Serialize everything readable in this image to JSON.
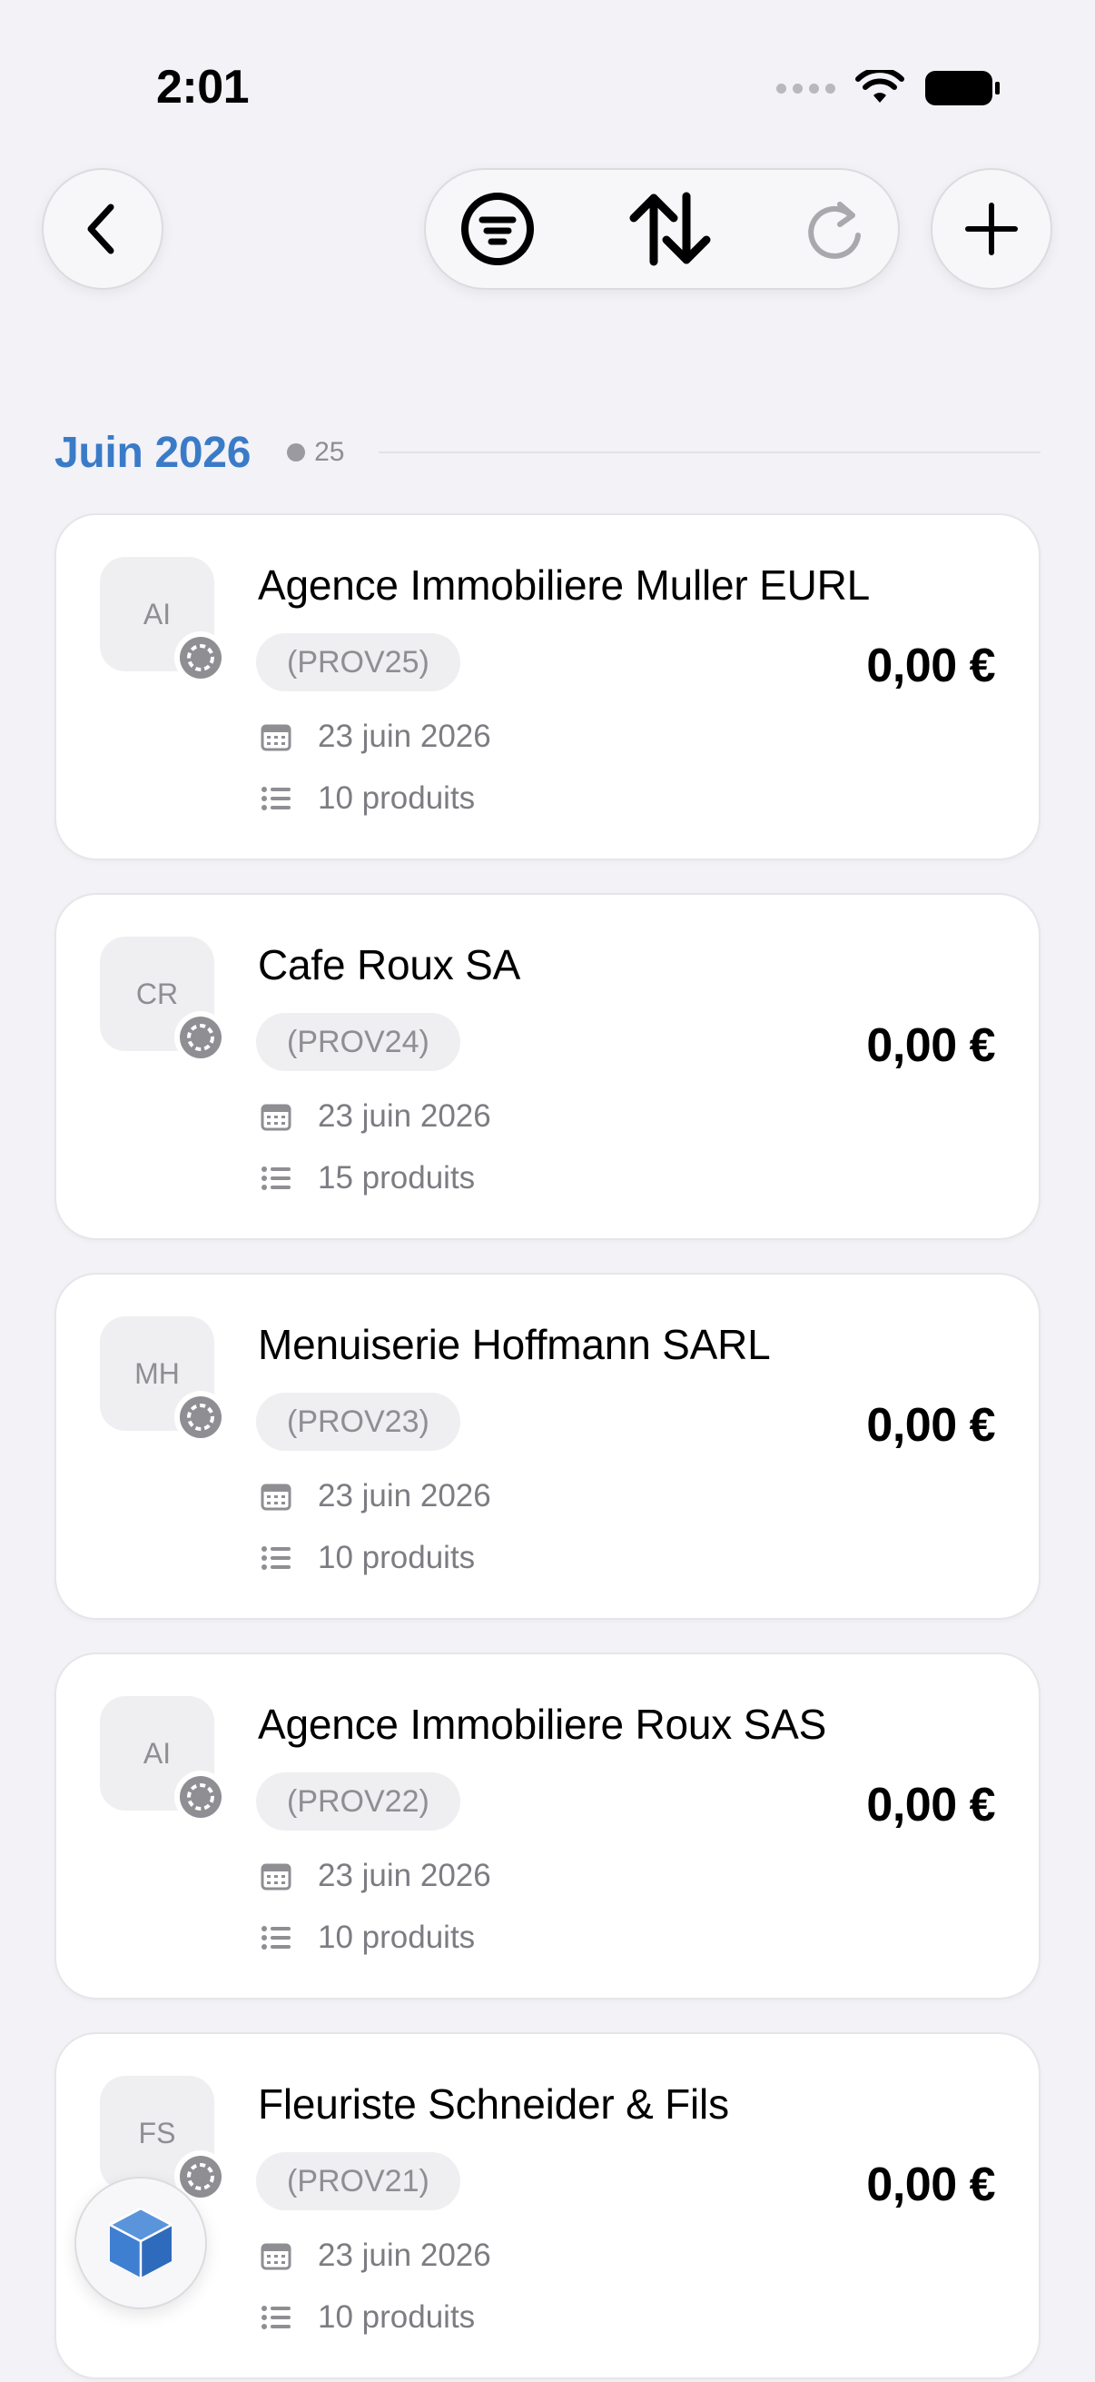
{
  "status_bar": {
    "time": "2:01"
  },
  "section": {
    "title": "Juin 2026",
    "count": "25"
  },
  "documents": [
    {
      "initials": "AI",
      "name": "Agence Immobiliere Muller EURL",
      "reference": "(PROV25)",
      "amount": "0,00 €",
      "date": "23 juin 2026",
      "items": "10 produits"
    },
    {
      "initials": "CR",
      "name": "Cafe Roux SA",
      "reference": "(PROV24)",
      "amount": "0,00 €",
      "date": "23 juin 2026",
      "items": "15 produits"
    },
    {
      "initials": "MH",
      "name": "Menuiserie Hoffmann SARL",
      "reference": "(PROV23)",
      "amount": "0,00 €",
      "date": "23 juin 2026",
      "items": "10 produits"
    },
    {
      "initials": "AI",
      "name": "Agence Immobiliere Roux SAS",
      "reference": "(PROV22)",
      "amount": "0,00 €",
      "date": "23 juin 2026",
      "items": "10 produits"
    },
    {
      "initials": "FS",
      "name": "Fleuriste Schneider & Fils",
      "reference": "(PROV21)",
      "amount": "0,00 €",
      "date": "23 juin 2026",
      "items": "10 produits"
    }
  ],
  "icons": {
    "back": "chevron-left-icon",
    "filter": "filter-lines-icon",
    "sort": "sort-arrows-icon",
    "refresh": "refresh-icon",
    "add": "plus-icon",
    "fab": "box-icon"
  },
  "colors": {
    "accent": "#3a7bc8",
    "background": "#f2f2f7",
    "fab_icon": "#3f7fd1"
  }
}
